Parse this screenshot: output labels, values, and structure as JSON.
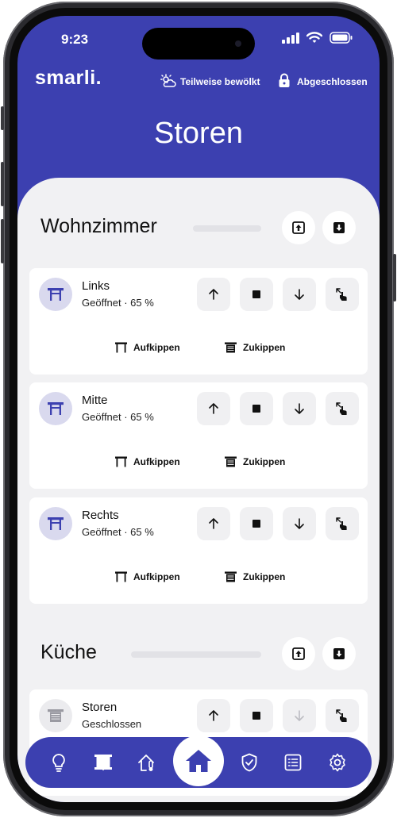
{
  "status": {
    "time": "9:23"
  },
  "header": {
    "brand": "smarli.",
    "weather": "Teilweise bewölkt",
    "lock": "Abgeschlossen",
    "title": "Storen"
  },
  "rooms": [
    {
      "name": "Wohnzimmer",
      "devices": [
        {
          "name": "Links",
          "status": "Geöffnet · 65 %",
          "tilt_open": "Aufkippen",
          "tilt_close": "Zukippen"
        },
        {
          "name": "Mitte",
          "status": "Geöffnet · 65 %",
          "tilt_open": "Aufkippen",
          "tilt_close": "Zukippen"
        },
        {
          "name": "Rechts",
          "status": "Geöffnet · 65 %",
          "tilt_open": "Aufkippen",
          "tilt_close": "Zukippen"
        }
      ]
    },
    {
      "name": "Küche",
      "devices": [
        {
          "name": "Storen",
          "status": "Geschlossen"
        }
      ]
    }
  ],
  "nav": {
    "items": [
      "light-bulb-icon",
      "blind-icon",
      "thermostat-icon",
      "home-icon",
      "shield-icon",
      "list-icon",
      "gear-icon"
    ],
    "active": "home-icon"
  },
  "colors": {
    "primary": "#3c40b0",
    "background": "#f1f1f3",
    "card": "#ffffff",
    "icon_bg": "#d9d9ee"
  }
}
